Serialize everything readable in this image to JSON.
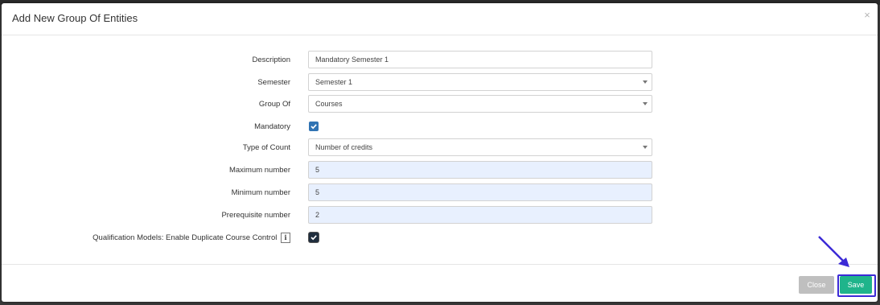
{
  "modal": {
    "title": "Add New Group Of Entities",
    "close_glyph": "×"
  },
  "form": {
    "description": {
      "label": "Description",
      "value": "Mandatory Semester 1"
    },
    "semester": {
      "label": "Semester",
      "value": "Semester 1"
    },
    "group_of": {
      "label": "Group Of",
      "value": "Courses"
    },
    "mandatory": {
      "label": "Mandatory",
      "checked": true
    },
    "type_of_count": {
      "label": "Type of Count",
      "value": "Number of credits"
    },
    "maximum_number": {
      "label": "Maximum number",
      "value": "5"
    },
    "minimum_number": {
      "label": "Minimum number",
      "value": "5"
    },
    "prerequisite_number": {
      "label": "Prerequisite number",
      "value": "2"
    },
    "duplicate_control": {
      "label": "Qualification Models: Enable Duplicate Course Control",
      "info_glyph": "i",
      "checked": true
    }
  },
  "footer": {
    "close_label": "Close",
    "save_label": "Save"
  },
  "colors": {
    "save_button": "#1fb48b",
    "close_button": "#bfbfbf",
    "checkbox": "#3073b3",
    "highlight": "#3b2ad6"
  },
  "icons": {
    "close": "close-icon",
    "caret": "chevron-down-icon",
    "info": "info-icon",
    "check": "check-icon",
    "arrow": "pointer-arrow-icon"
  }
}
